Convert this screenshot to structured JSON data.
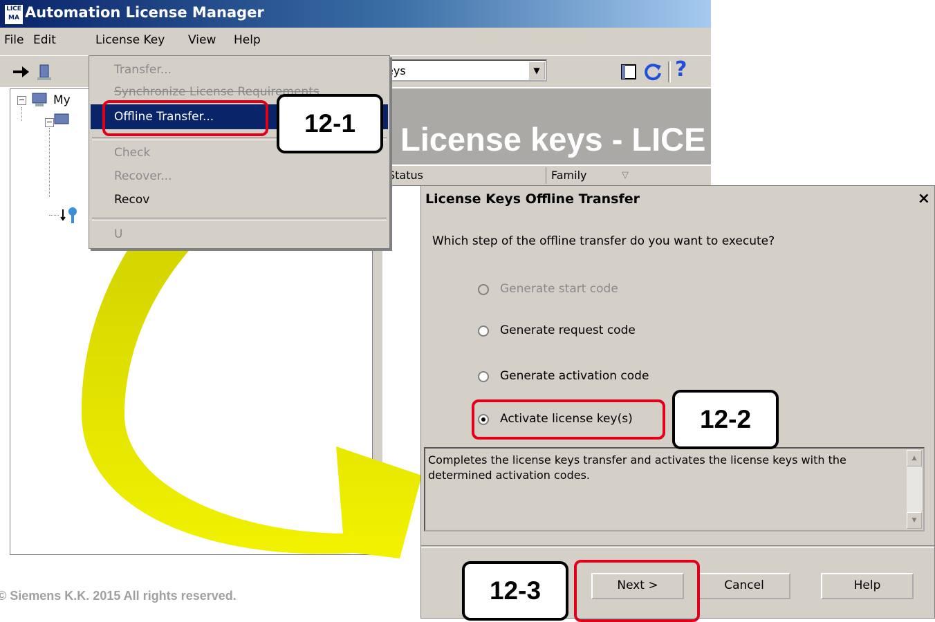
{
  "window": {
    "title": "Automation License Manager",
    "icon_text": "LICE MA"
  },
  "menubar": {
    "items": [
      "File",
      "Edit",
      "License Key",
      "View",
      "Help"
    ]
  },
  "toolbar": {
    "view_select_value": "eys"
  },
  "tree": {
    "root_label": "My"
  },
  "license_menu": {
    "items": [
      {
        "label": "Transfer...",
        "enabled": false
      },
      {
        "label": "Synchronize License Requirements",
        "enabled": false
      },
      {
        "label": "Offline Transfer...",
        "enabled": true,
        "highlighted": true
      },
      {
        "label": "Check",
        "enabled": false
      },
      {
        "label": "Recover...",
        "enabled": false
      },
      {
        "label": "Recov",
        "enabled": true
      },
      {
        "label": "U",
        "enabled": false
      }
    ]
  },
  "right_pane": {
    "banner": "License keys - LICE",
    "columns": [
      "Status",
      "Family"
    ]
  },
  "dialog": {
    "title": "License Keys Offline Transfer",
    "close": "×",
    "question": "Which step of the offline transfer do you want to execute?",
    "options": [
      {
        "label": "Generate start code",
        "enabled": false,
        "selected": false
      },
      {
        "label": "Generate request code",
        "enabled": true,
        "selected": false
      },
      {
        "label": "Generate activation code",
        "enabled": true,
        "selected": false
      },
      {
        "label": "Activate license key(s)",
        "enabled": true,
        "selected": true
      }
    ],
    "description": "Completes the license keys transfer and activates the license keys with the determined activation codes.",
    "buttons": {
      "next": "Next >",
      "cancel": "Cancel",
      "help": "Help"
    }
  },
  "callouts": {
    "step1": "12-1",
    "step2": "12-2",
    "step3": "12-3"
  },
  "footer": {
    "copyright": "© Siemens K.K. 2015 All rights reserved."
  },
  "colors": {
    "highlight": "#0a246a",
    "callout_red": "#e0001a",
    "arrow_yellow": "#e6e600"
  }
}
